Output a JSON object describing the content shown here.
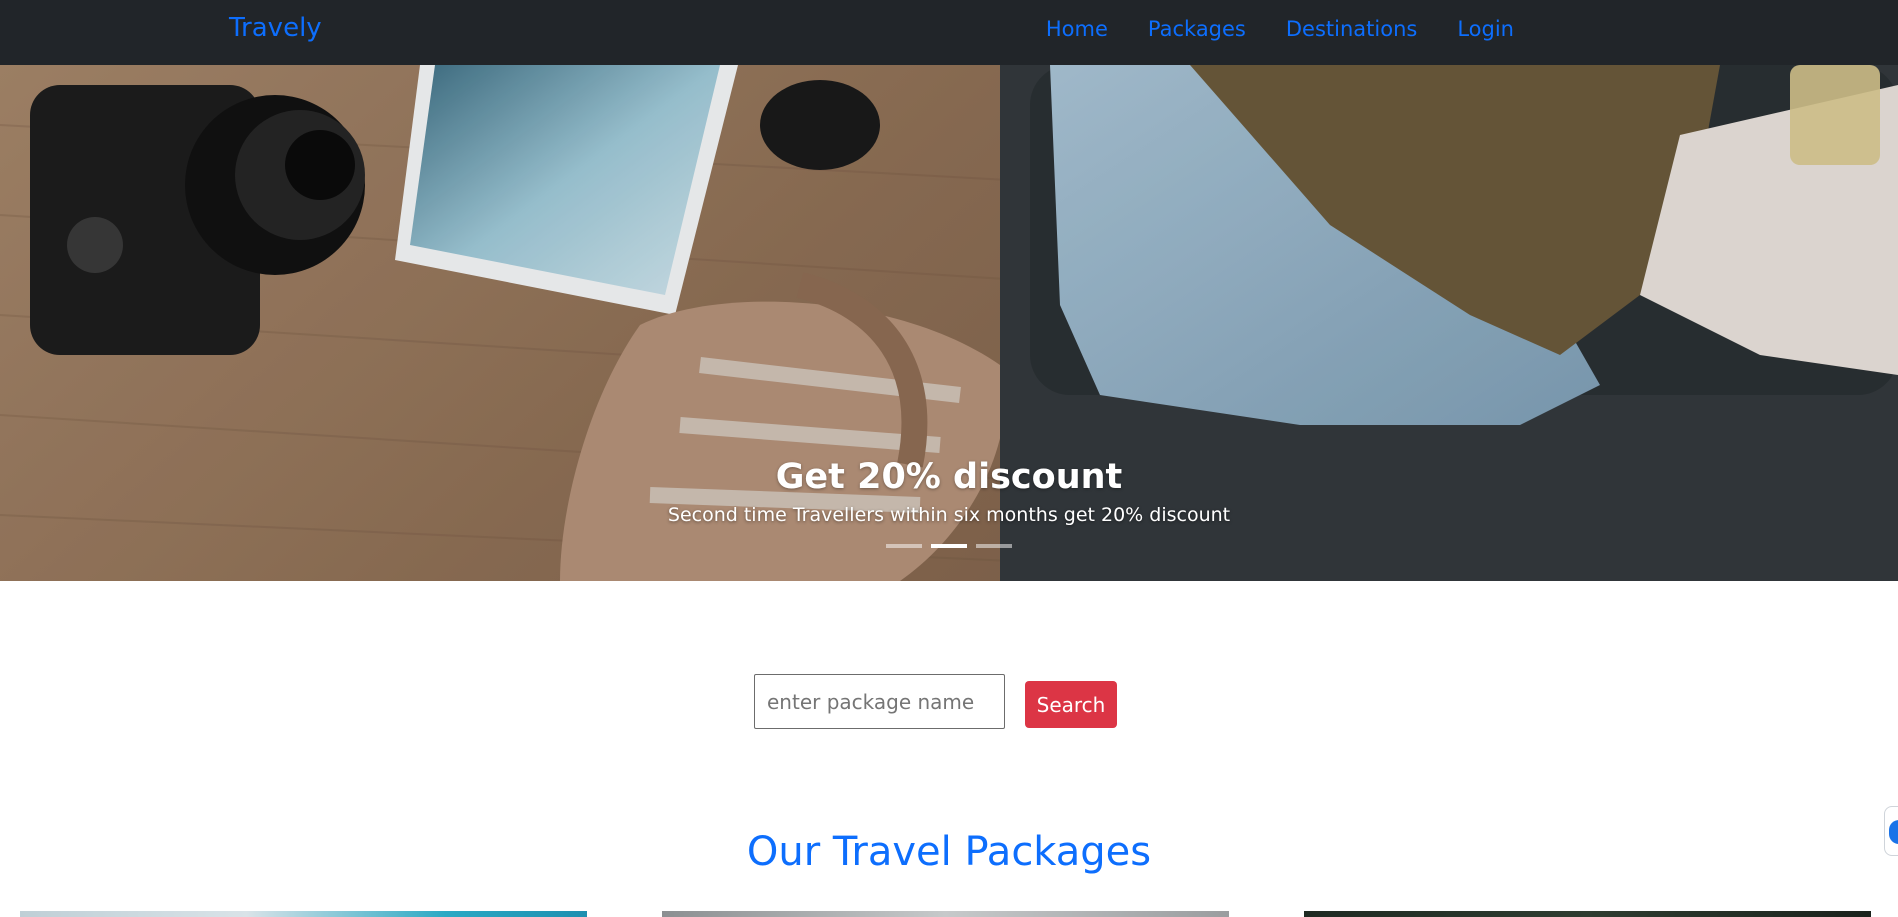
{
  "navbar": {
    "brand": "Travely",
    "links": [
      {
        "label": "Home"
      },
      {
        "label": "Packages"
      },
      {
        "label": "Destinations"
      },
      {
        "label": "Login"
      }
    ]
  },
  "carousel": {
    "title": "Get 20% discount",
    "text": "Second time Travellers within six months get 20% discount",
    "indicator_count": 3,
    "active_index": 1
  },
  "search": {
    "placeholder": "enter package name",
    "value": "",
    "button_label": "Search"
  },
  "packages_section": {
    "title": "Our Travel Packages"
  },
  "colors": {
    "navbar_bg": "#212529",
    "link": "#0d6efd",
    "search_button": "#dc3545",
    "section_title": "#0d6efd"
  },
  "icons": {
    "side_widget": "chat-widget-icon"
  }
}
